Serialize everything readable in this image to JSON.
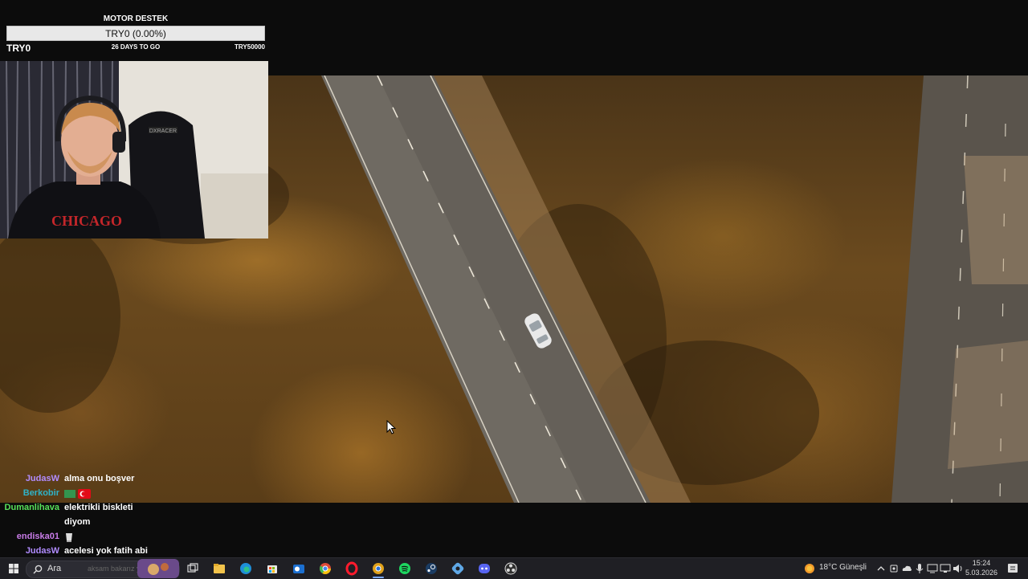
{
  "goal": {
    "title": "MOTOR DESTEK",
    "bar_text": "TRY0 (0.00%)",
    "progress_percent": 0,
    "current": "TRY0",
    "days_left": "26 DAYS TO GO",
    "target": "TRY50000",
    "colors": {
      "fill": "#6fbf4f",
      "bar_bg": "#e8e8e8"
    }
  },
  "webcam": {
    "shirt_text": "CHICAGO",
    "chair_brand": "DXRACER"
  },
  "chat": {
    "messages": [
      {
        "user": "JudasW",
        "text": "alma onu boşver",
        "color": "#b18cff"
      },
      {
        "user": "Berkobir",
        "text": "",
        "emote": "turkish-flag-emote",
        "color": "#2fb3c8"
      },
      {
        "user": "Dumanlihava",
        "text": "elektrikli biskleti",
        "color": "#57e05a"
      },
      {
        "user": "",
        "text": "diyom",
        "color": "#57e05a"
      },
      {
        "user": "endiska01",
        "text": "",
        "emote": "cup-emote",
        "color": "#c97ce8"
      },
      {
        "user": "JudasW",
        "text": "acelesi yok fatih abi",
        "color": "#b18cff"
      }
    ]
  },
  "taskbar": {
    "search_label": "Ara",
    "search_hint": "aksam bakarız yine",
    "weather": "18°C  Güneşli",
    "time": "15:24",
    "date": "5.03.2026",
    "icons": [
      "windows-start-icon",
      "search-icon",
      "task-view-icon",
      "file-explorer-icon",
      "edge-icon",
      "store-icon",
      "outlook-icon",
      "chrome-icon",
      "opera-icon",
      "chrome-canary-icon",
      "spotify-icon",
      "steam-icon",
      "app-icon",
      "discord-icon",
      "obs-icon"
    ]
  }
}
